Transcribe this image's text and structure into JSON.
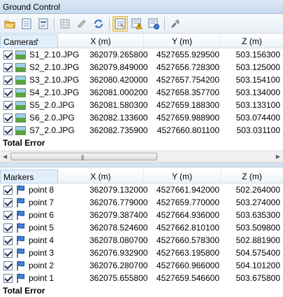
{
  "title": "Ground Control",
  "toolbar": {
    "buttons": [
      {
        "icon": "open-folder-icon"
      },
      {
        "icon": "import-icon"
      },
      {
        "icon": "export-icon"
      },
      {
        "icon": "grid-icon"
      },
      {
        "icon": "pencil-icon"
      },
      {
        "icon": "refresh-icon"
      },
      {
        "icon": "view-source-icon"
      },
      {
        "icon": "warning-icon"
      },
      {
        "icon": "view-estimated-icon"
      },
      {
        "icon": "settings-icon"
      }
    ]
  },
  "cameras": {
    "header": {
      "name": "Cameras",
      "x": "X (m)",
      "y": "Y (m)",
      "z": "Z (m)"
    },
    "rows": [
      {
        "name": "S1_2.10.JPG",
        "x": "362079.265800",
        "y": "4527655.929500",
        "z": "503.156300"
      },
      {
        "name": "S2_2.10.JPG",
        "x": "362079.849000",
        "y": "4527656.728300",
        "z": "503.125000"
      },
      {
        "name": "S3_2.10.JPG",
        "x": "362080.420000",
        "y": "4527657.754200",
        "z": "503.154100"
      },
      {
        "name": "S4_2.10.JPG",
        "x": "362081.000200",
        "y": "4527658.357700",
        "z": "503.134000"
      },
      {
        "name": "S5_2.0.JPG",
        "x": "362081.580300",
        "y": "4527659.188300",
        "z": "503.133100"
      },
      {
        "name": "S6_2.0.JPG",
        "x": "362082.133600",
        "y": "4527659.988900",
        "z": "503.074400"
      },
      {
        "name": "S7_2.0.JPG",
        "x": "362082.735900",
        "y": "4527660.801100",
        "z": "503.031100"
      }
    ],
    "total": "Total Error"
  },
  "markers": {
    "header": {
      "name": "Markers",
      "x": "X (m)",
      "y": "Y (m)",
      "z": "Z (m)"
    },
    "rows": [
      {
        "name": "point 8",
        "x": "362079.132000",
        "y": "4527661.942000",
        "z": "502.264000"
      },
      {
        "name": "point 7",
        "x": "362076.779000",
        "y": "4527659.770000",
        "z": "503.274000"
      },
      {
        "name": "point 6",
        "x": "362079.387400",
        "y": "4527664.936000",
        "z": "503.635300"
      },
      {
        "name": "point 5",
        "x": "362078.524600",
        "y": "4527662.810100",
        "z": "503.509800"
      },
      {
        "name": "point 4",
        "x": "362078.080700",
        "y": "4527660.578300",
        "z": "502.881900"
      },
      {
        "name": "point 3",
        "x": "362076.932900",
        "y": "4527663.195800",
        "z": "504.575400"
      },
      {
        "name": "point 2",
        "x": "362076.280700",
        "y": "4527660.966000",
        "z": "504.101200"
      },
      {
        "name": "point 1",
        "x": "362075.655800",
        "y": "4527659.546600",
        "z": "503.675800"
      }
    ],
    "total": "Total Error"
  }
}
